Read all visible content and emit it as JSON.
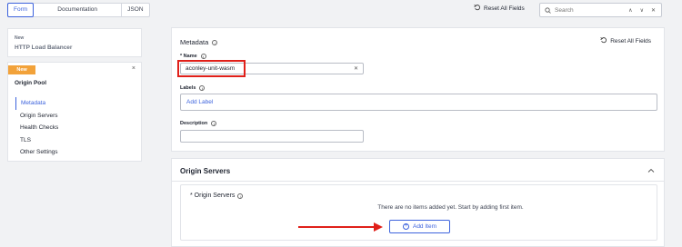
{
  "tabs": [
    {
      "label": "Form"
    },
    {
      "label": "Documentation"
    },
    {
      "label": "JSON"
    }
  ],
  "toolbar": {
    "reset_label": "Reset All Fields",
    "search_placeholder": "Search"
  },
  "sidebar": {
    "card1": {
      "status": "New",
      "title": "HTTP Load Balancer"
    },
    "card2": {
      "badge": "New",
      "close": "×",
      "title": "Origin Pool",
      "items": [
        {
          "label": "Metadata"
        },
        {
          "label": "Origin Servers"
        },
        {
          "label": "Health Checks"
        },
        {
          "label": "TLS"
        },
        {
          "label": "Other Settings"
        }
      ]
    }
  },
  "metadata": {
    "title": "Metadata",
    "reset_label": "Reset All Fields",
    "name_label": "* Name",
    "name_value": "aconley-unit-wasm",
    "labels_label": "Labels",
    "labels_placeholder": "Add Label",
    "description_label": "Description",
    "description_value": ""
  },
  "origin_servers": {
    "section_title": "Origin Servers",
    "field_label": "* Origin Servers",
    "empty_text": "There are no items added yet. Start by adding first item.",
    "add_label": "Add Item"
  },
  "colors": {
    "accent": "#3d63dd",
    "badge": "#f2a23a",
    "highlight": "#e0201a"
  },
  "icons": {
    "search": "search-icon",
    "reset": "reset-icon",
    "info": "info-icon",
    "close": "close-icon",
    "chevron_up": "chevron-up-icon",
    "add": "plus-circle-icon"
  }
}
